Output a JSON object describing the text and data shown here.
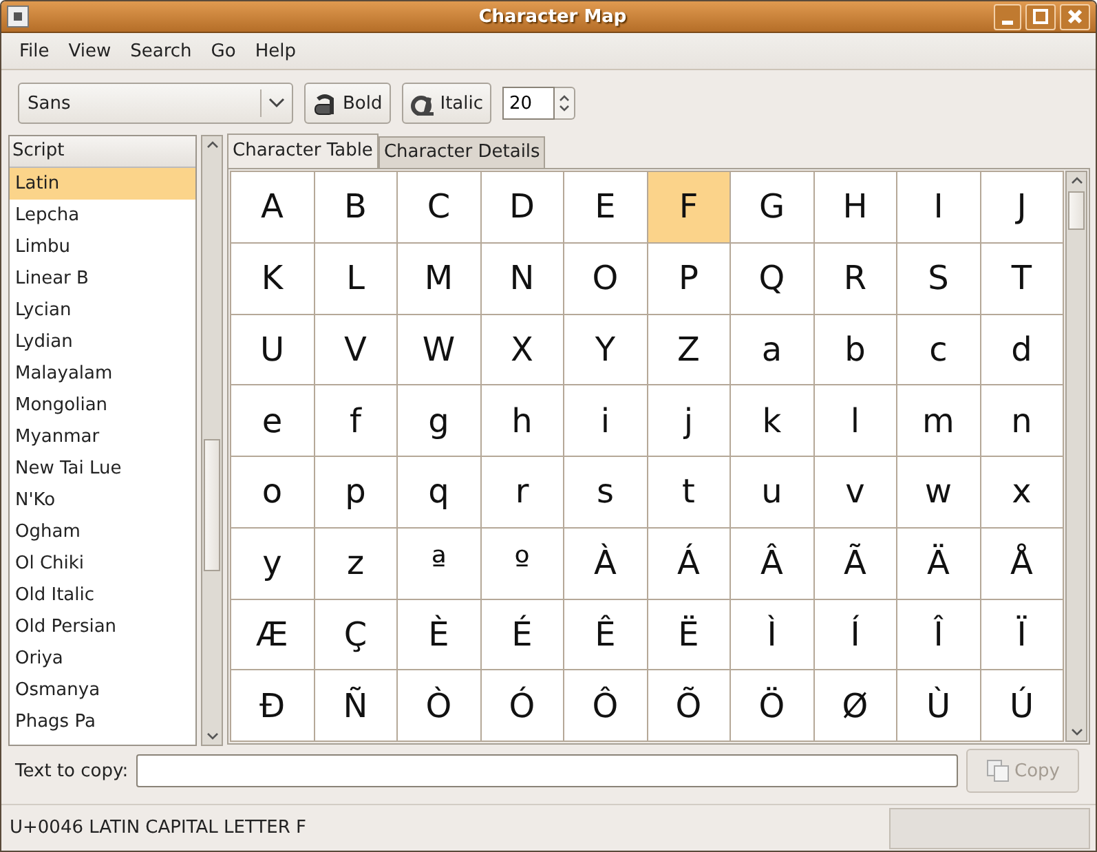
{
  "window": {
    "title": "Character Map"
  },
  "menu": [
    "File",
    "View",
    "Search",
    "Go",
    "Help"
  ],
  "toolbar": {
    "font": "Sans",
    "bold": {
      "label": "Bold",
      "checked": false
    },
    "italic": {
      "label": "Italic",
      "checked": false
    },
    "size": "20"
  },
  "script_list": {
    "header": "Script",
    "items": [
      {
        "label": "Latin",
        "selected": true
      },
      {
        "label": "Lepcha",
        "selected": false
      },
      {
        "label": "Limbu",
        "selected": false
      },
      {
        "label": "Linear B",
        "selected": false
      },
      {
        "label": "Lycian",
        "selected": false
      },
      {
        "label": "Lydian",
        "selected": false
      },
      {
        "label": "Malayalam",
        "selected": false
      },
      {
        "label": "Mongolian",
        "selected": false
      },
      {
        "label": "Myanmar",
        "selected": false
      },
      {
        "label": "New Tai Lue",
        "selected": false
      },
      {
        "label": "N'Ko",
        "selected": false
      },
      {
        "label": "Ogham",
        "selected": false
      },
      {
        "label": "Ol Chiki",
        "selected": false
      },
      {
        "label": "Old Italic",
        "selected": false
      },
      {
        "label": "Old Persian",
        "selected": false
      },
      {
        "label": "Oriya",
        "selected": false
      },
      {
        "label": "Osmanya",
        "selected": false
      },
      {
        "label": "Phags Pa",
        "selected": false
      }
    ]
  },
  "tabs": [
    {
      "label": "Character Table",
      "selected": true
    },
    {
      "label": "Character Details",
      "selected": false
    }
  ],
  "characters": [
    {
      "char": "A",
      "selected": false
    },
    {
      "char": "B",
      "selected": false
    },
    {
      "char": "C",
      "selected": false
    },
    {
      "char": "D",
      "selected": false
    },
    {
      "char": "E",
      "selected": false
    },
    {
      "char": "F",
      "selected": true
    },
    {
      "char": "G",
      "selected": false
    },
    {
      "char": "H",
      "selected": false
    },
    {
      "char": "I",
      "selected": false
    },
    {
      "char": "J",
      "selected": false
    },
    {
      "char": "K",
      "selected": false
    },
    {
      "char": "L",
      "selected": false
    },
    {
      "char": "M",
      "selected": false
    },
    {
      "char": "N",
      "selected": false
    },
    {
      "char": "O",
      "selected": false
    },
    {
      "char": "P",
      "selected": false
    },
    {
      "char": "Q",
      "selected": false
    },
    {
      "char": "R",
      "selected": false
    },
    {
      "char": "S",
      "selected": false
    },
    {
      "char": "T",
      "selected": false
    },
    {
      "char": "U",
      "selected": false
    },
    {
      "char": "V",
      "selected": false
    },
    {
      "char": "W",
      "selected": false
    },
    {
      "char": "X",
      "selected": false
    },
    {
      "char": "Y",
      "selected": false
    },
    {
      "char": "Z",
      "selected": false
    },
    {
      "char": "a",
      "selected": false
    },
    {
      "char": "b",
      "selected": false
    },
    {
      "char": "c",
      "selected": false
    },
    {
      "char": "d",
      "selected": false
    },
    {
      "char": "e",
      "selected": false
    },
    {
      "char": "f",
      "selected": false
    },
    {
      "char": "g",
      "selected": false
    },
    {
      "char": "h",
      "selected": false
    },
    {
      "char": "i",
      "selected": false
    },
    {
      "char": "j",
      "selected": false
    },
    {
      "char": "k",
      "selected": false
    },
    {
      "char": "l",
      "selected": false
    },
    {
      "char": "m",
      "selected": false
    },
    {
      "char": "n",
      "selected": false
    },
    {
      "char": "o",
      "selected": false
    },
    {
      "char": "p",
      "selected": false
    },
    {
      "char": "q",
      "selected": false
    },
    {
      "char": "r",
      "selected": false
    },
    {
      "char": "s",
      "selected": false
    },
    {
      "char": "t",
      "selected": false
    },
    {
      "char": "u",
      "selected": false
    },
    {
      "char": "v",
      "selected": false
    },
    {
      "char": "w",
      "selected": false
    },
    {
      "char": "x",
      "selected": false
    },
    {
      "char": "y",
      "selected": false
    },
    {
      "char": "z",
      "selected": false
    },
    {
      "char": "ª",
      "selected": false
    },
    {
      "char": "º",
      "selected": false
    },
    {
      "char": "À",
      "selected": false
    },
    {
      "char": "Á",
      "selected": false
    },
    {
      "char": "Â",
      "selected": false
    },
    {
      "char": "Ã",
      "selected": false
    },
    {
      "char": "Ä",
      "selected": false
    },
    {
      "char": "Å",
      "selected": false
    },
    {
      "char": "Æ",
      "selected": false
    },
    {
      "char": "Ç",
      "selected": false
    },
    {
      "char": "È",
      "selected": false
    },
    {
      "char": "É",
      "selected": false
    },
    {
      "char": "Ê",
      "selected": false
    },
    {
      "char": "Ë",
      "selected": false
    },
    {
      "char": "Ì",
      "selected": false
    },
    {
      "char": "Í",
      "selected": false
    },
    {
      "char": "Î",
      "selected": false
    },
    {
      "char": "Ï",
      "selected": false
    },
    {
      "char": "Ð",
      "selected": false
    },
    {
      "char": "Ñ",
      "selected": false
    },
    {
      "char": "Ò",
      "selected": false
    },
    {
      "char": "Ó",
      "selected": false
    },
    {
      "char": "Ô",
      "selected": false
    },
    {
      "char": "Õ",
      "selected": false
    },
    {
      "char": "Ö",
      "selected": false
    },
    {
      "char": "Ø",
      "selected": false
    },
    {
      "char": "Ù",
      "selected": false
    },
    {
      "char": "Ú",
      "selected": false
    }
  ],
  "copy_row": {
    "label": "Text to copy:",
    "button": {
      "label": "Copy",
      "disabled": true
    }
  },
  "status_bar": "U+0046 LATIN CAPITAL LETTER F"
}
